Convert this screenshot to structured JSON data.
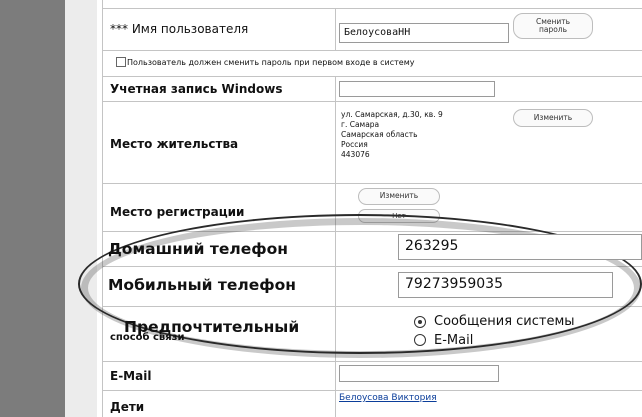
{
  "fields": {
    "username_label": "*** Имя пользователя",
    "username_value": "БелоусоваНН",
    "change_password_button": "Сменить\nпароль",
    "must_change_password_label": "Пользователь должен сменить пароль при первом входе в систему",
    "windows_account_label": "Учетная запись Windows",
    "residence_label": "Место жительства",
    "residence_address": [
      "ул. Самарская, д.30, кв. 9",
      "г. Самара",
      "Самарская область",
      "Россия",
      "443076"
    ],
    "residence_change_button": "Изменить",
    "registration_label": "Место регистрации",
    "registration_change_button": "Изменить",
    "registration_second_button": "Нет",
    "home_phone_label": "Домашний телефон",
    "home_phone_value": "263295",
    "mobile_phone_label": "Мобильный телефон",
    "mobile_phone_value": "79273959035",
    "preferred_method_label_line1": "Предпочтительный",
    "preferred_method_label_line2": "способ связи",
    "radio_option_1": "Сообщения системы",
    "radio_option_2": "E-Mail",
    "email_label": "E-Mail",
    "children_label": "Дети",
    "children_link": "Белоусова Виктория"
  }
}
